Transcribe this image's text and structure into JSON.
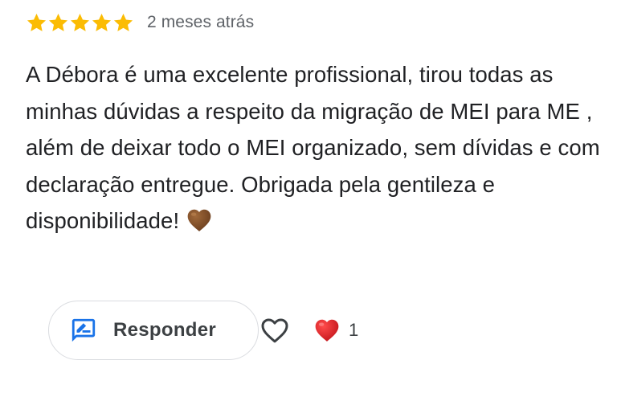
{
  "review": {
    "rating": 5,
    "max_rating": 5,
    "time_ago": "2 meses atrás",
    "text": "A Débora é uma excelente profissional, tirou todas as minhas dúvidas a respeito da migração de MEI para ME , além de deixar todo o MEI organizado, sem dívidas e com declaração entregue. Obrigada pela gentileza e disponibilidade!",
    "trailing_emoji": "brown-heart-emoji"
  },
  "actions": {
    "reply_label": "Responder",
    "reply_icon": "rate-review-icon",
    "like_icon": "heart-outline-icon",
    "reaction_emoji": "red-heart-emoji",
    "reaction_count": "1"
  },
  "colors": {
    "star": "#FBBC04",
    "accent_blue": "#1A73E8",
    "text": "#202124",
    "secondary_text": "#5F6368",
    "border": "#DADCE0",
    "brown_heart": "#8B5A2B",
    "red_heart": "#E53935"
  }
}
